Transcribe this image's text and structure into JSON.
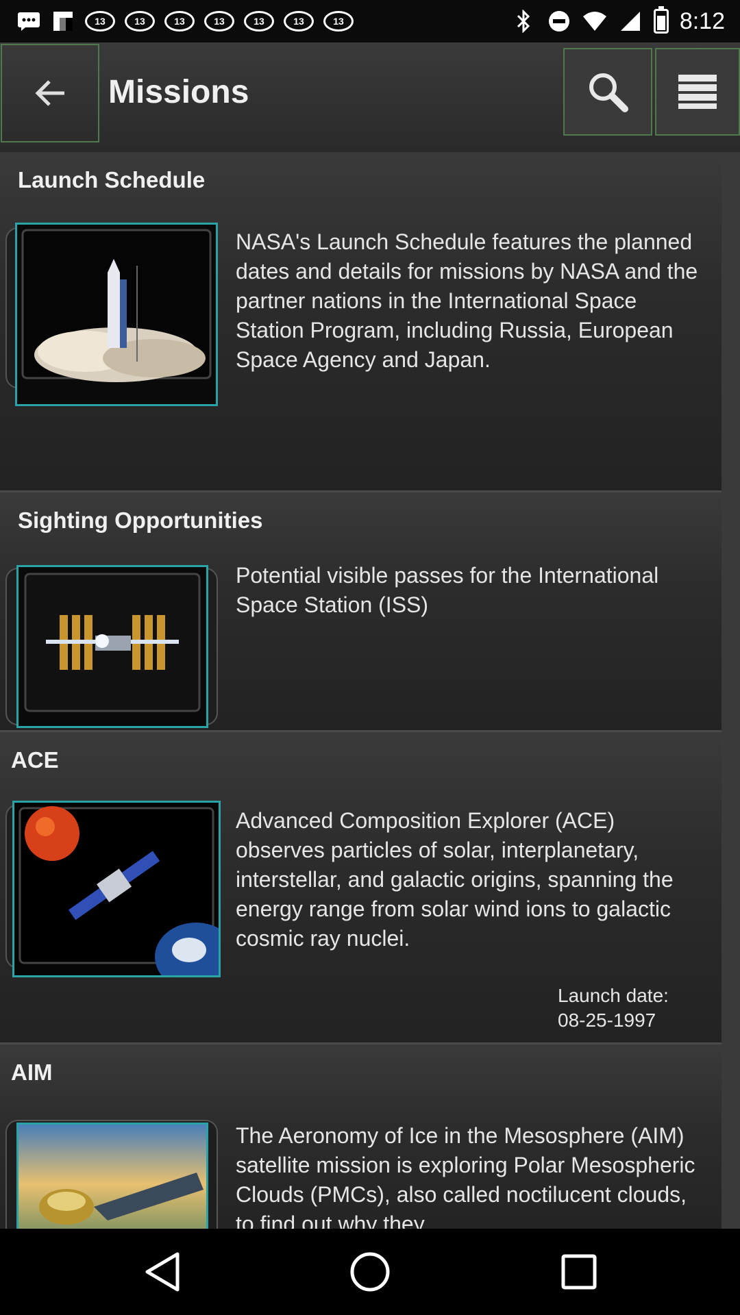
{
  "status_bar": {
    "time": "8:12",
    "badge_label": "13"
  },
  "app_bar": {
    "title": "Missions"
  },
  "sections": [
    {
      "title": "Launch Schedule",
      "description": "NASA's Launch Schedule features the planned dates and details for missions by NASA and the partner nations in the International Space Station Program, including Russia, European Space Agency and Japan."
    },
    {
      "title": "Sighting Opportunities",
      "description": "Potential visible passes for the International Space Station (ISS)"
    },
    {
      "title": "ACE",
      "description": "Advanced Composition Explorer (ACE) observes particles of solar, interplanetary, interstellar, and galactic origins, spanning the energy range from solar wind ions to galactic cosmic ray nuclei.",
      "launch_date_label": "Launch date:",
      "launch_date": "08-25-1997"
    },
    {
      "title": "AIM",
      "description": "The Aeronomy of Ice in the Mesosphere (AIM) satellite mission is exploring Polar Mesospheric Clouds (PMCs), also called noctilucent clouds, to find out why they"
    }
  ],
  "colors": {
    "thumb_border": "#2aa3a8",
    "button_border": "#4f7a4f",
    "background": "#2a2a2a"
  }
}
